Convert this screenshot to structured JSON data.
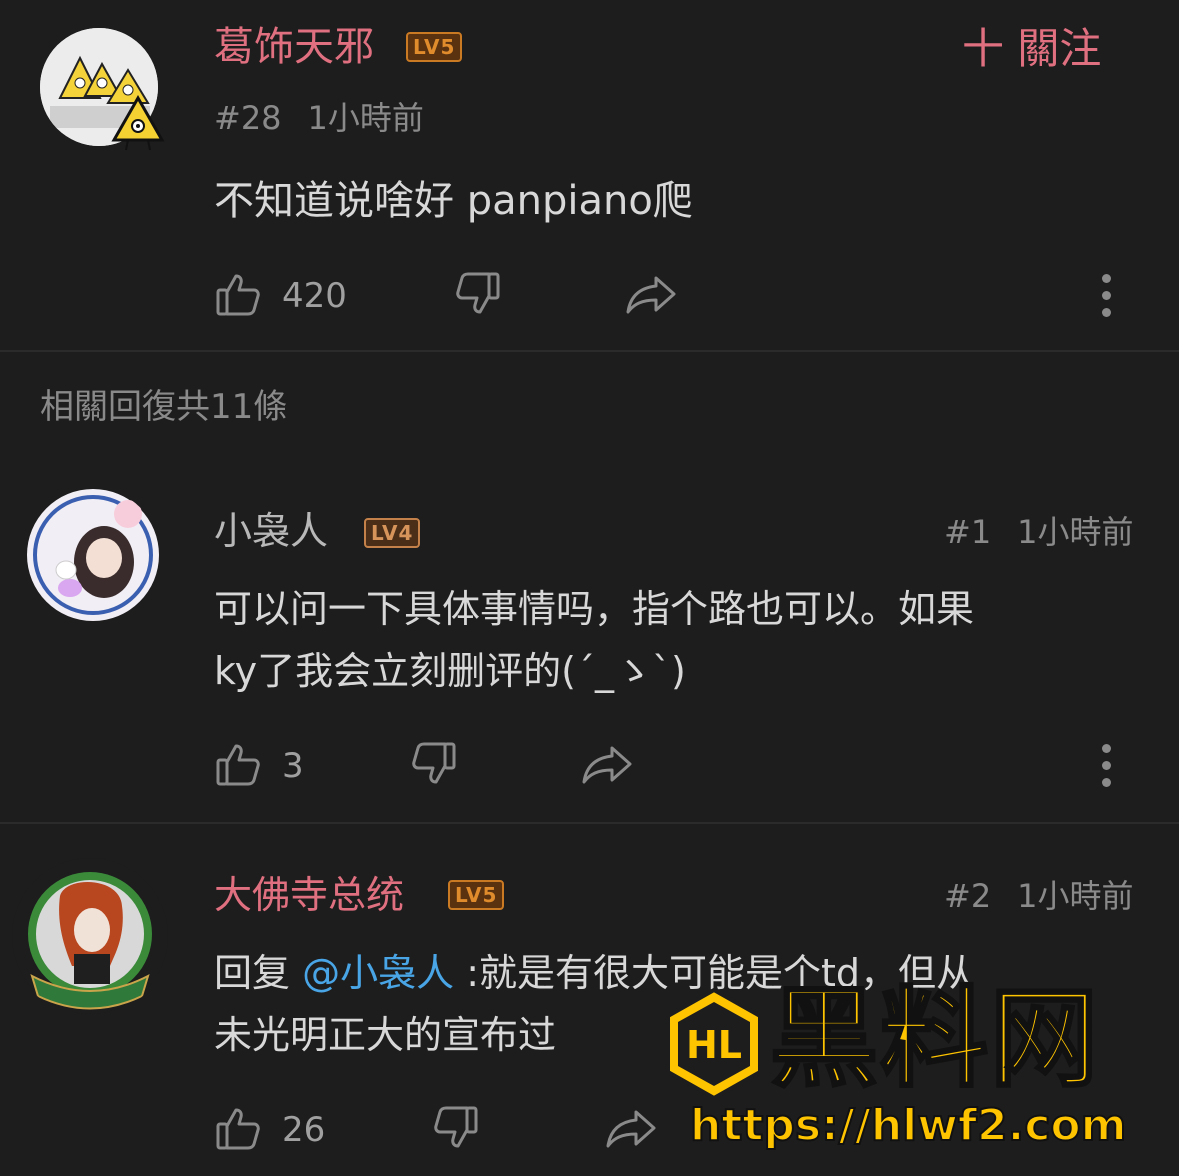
{
  "main_comment": {
    "username": "葛饰天邪",
    "level": "LV5",
    "follow_label": "十 關注",
    "floor": "#28",
    "time": "1小時前",
    "text": "不知道说啥好 panpiano爬",
    "likes": "420"
  },
  "replies_header": "相關回復共11條",
  "replies": [
    {
      "username": "小袅人",
      "level": "LV4",
      "floor": "#1",
      "time": "1小時前",
      "text_line1": "可以问一下具体事情吗，指个路也可以。如果",
      "text_line2": "ky了我会立刻删评的(´_ゝ`)",
      "likes": "3"
    },
    {
      "username": "大佛寺总统",
      "level": "LV5",
      "floor": "#2",
      "time": "1小時前",
      "reply_prefix": "回复",
      "mention": "@小袅人",
      "text_line1_rest": ":就是有很大可能是个td，但从",
      "text_line2": "未光明正大的宣布过",
      "likes": "26"
    }
  ],
  "watermark": {
    "logo_text": "HL",
    "title": "黑料网",
    "url": "https://hlwf2.com"
  },
  "colors": {
    "username_pink": "#e07080",
    "username_gray": "#b8b8b8",
    "mention_blue": "#49a5e6",
    "level_orange": "#e08c2c",
    "watermark_yellow": "#ffc400"
  },
  "icons": [
    "thumbs-up-icon",
    "thumbs-down-icon",
    "share-icon",
    "more-vertical-icon"
  ]
}
